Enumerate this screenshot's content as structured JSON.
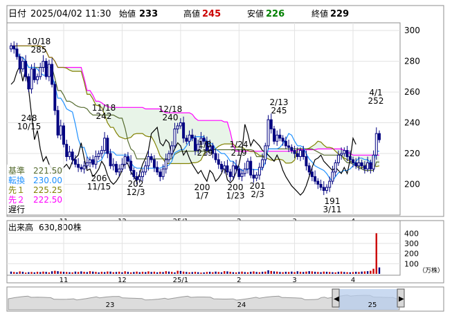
{
  "header": {
    "date_label": "日付",
    "date_value": "2025/04/02 11:30",
    "open_label": "始値",
    "open_value": "233",
    "high_label": "高値",
    "high_value": "245",
    "low_label": "安値",
    "low_value": "226",
    "close_label": "終値",
    "close_value": "229"
  },
  "legend": [
    {
      "label": "基準",
      "value": "221.50",
      "color": "#556b2f"
    },
    {
      "label": "転換",
      "value": "230.00",
      "color": "#1e90ff"
    },
    {
      "label": "先１",
      "value": "225.25",
      "color": "#808000"
    },
    {
      "label": "先２",
      "value": "222.50",
      "color": "#ff00ff"
    },
    {
      "label": "遅行",
      "value": "",
      "color": "#000000"
    }
  ],
  "volume_panel": {
    "label": "出来高",
    "value": "630,800株",
    "unit": "（万株）"
  },
  "colors": {
    "candle": "#000080",
    "kumo": "#e8f4e8",
    "kijun": "#556b2f",
    "tenkan": "#1e90ff",
    "senkou1": "#808000",
    "senkou2": "#ff00ff",
    "chikou": "#000000",
    "volume_bar": "#000080",
    "volume_highlight": "#cc0000"
  },
  "chart_data": [
    {
      "type": "candlestick",
      "title": "",
      "ylim": [
        180,
        305
      ],
      "yticks": [
        "200",
        "220",
        "240",
        "260",
        "280",
        "300"
      ],
      "xticks": [
        "11",
        "12",
        "25/1",
        "2",
        "3",
        "4"
      ],
      "annotations": [
        {
          "date": "10/18",
          "value": "285"
        },
        {
          "date": "10/15",
          "value": "248"
        },
        {
          "date": "11/18",
          "value": "242"
        },
        {
          "date": "11/15",
          "value": "206"
        },
        {
          "date": "12/3",
          "value": "202"
        },
        {
          "date": "12/18",
          "value": "240"
        },
        {
          "date": "1/7",
          "value": "200"
        },
        {
          "date": "1/8",
          "value": "219"
        },
        {
          "date": "1/23",
          "value": "200"
        },
        {
          "date": "1/24",
          "value": "219"
        },
        {
          "date": "2/3",
          "value": "201"
        },
        {
          "date": "2/13",
          "value": "245"
        },
        {
          "date": "3/11",
          "value": "191"
        },
        {
          "date": "4/1",
          "value": "252"
        }
      ],
      "series": [
        {
          "name": "基準",
          "last": 221.5
        },
        {
          "name": "転換",
          "last": 230.0
        },
        {
          "name": "先１",
          "last": 225.25
        },
        {
          "name": "先２",
          "last": 222.5
        }
      ],
      "close_path": [
        290,
        288,
        283,
        275,
        280,
        270,
        262,
        275,
        268,
        270,
        276,
        280,
        270,
        278,
        265,
        248,
        232,
        238,
        226,
        218,
        221,
        216,
        213,
        211,
        210,
        212,
        214,
        216,
        213,
        218,
        220,
        222,
        230,
        220,
        212,
        213,
        208,
        210,
        213,
        218,
        215,
        209,
        205,
        203,
        205,
        208,
        212,
        218,
        216,
        211,
        208,
        205,
        210,
        216,
        220,
        225,
        236,
        238,
        240,
        230,
        228,
        232,
        230,
        222,
        226,
        230,
        228,
        222,
        225,
        220,
        216,
        213,
        210,
        212,
        208,
        205,
        212,
        210,
        205,
        207,
        210,
        215,
        206,
        204,
        206,
        211,
        216,
        225,
        242,
        236,
        228,
        232,
        230,
        228,
        225,
        224,
        222,
        220,
        218,
        222,
        218,
        212,
        208,
        205,
        202,
        200,
        198,
        196,
        198,
        202,
        208,
        214,
        219,
        220,
        222,
        218,
        216,
        214,
        212,
        214,
        212,
        210,
        214,
        210,
        219,
        233,
        229
      ]
    },
    {
      "type": "bar",
      "title": "",
      "ylim": [
        0,
        450
      ],
      "yticks": [
        "400",
        "300",
        "200",
        "100"
      ],
      "xticks": [
        "11",
        "12",
        "25/1",
        "2",
        "3",
        "4"
      ],
      "values": [
        22,
        18,
        15,
        24,
        20,
        12,
        16,
        18,
        14,
        20,
        17,
        22,
        19,
        14,
        25,
        30,
        26,
        22,
        20,
        18,
        16,
        14,
        22,
        18,
        24,
        20,
        17,
        26,
        22,
        19,
        14,
        20,
        17,
        23,
        22,
        16,
        18,
        21,
        15,
        25,
        19,
        14,
        18,
        22,
        16,
        20,
        17,
        24,
        18,
        21,
        15,
        20,
        17,
        26,
        22,
        19,
        14,
        30,
        28,
        22,
        18,
        15,
        17,
        20,
        16,
        12,
        14,
        18,
        20,
        16,
        22,
        18,
        15,
        26,
        24,
        20,
        16,
        14,
        18,
        22,
        17,
        15,
        20,
        24,
        18,
        16,
        20,
        22,
        35,
        28,
        24,
        22,
        18,
        16,
        20,
        18,
        22,
        17,
        25,
        20,
        18,
        22,
        26,
        24,
        20,
        18,
        16,
        22,
        20,
        18,
        16,
        14,
        20,
        22,
        18,
        16,
        15,
        17,
        20,
        18,
        22,
        24,
        26,
        30,
        50,
        400,
        63
      ],
      "highlight_index": 124
    },
    {
      "type": "area",
      "title": "",
      "xticks": [
        "23",
        "24",
        "25"
      ]
    }
  ]
}
